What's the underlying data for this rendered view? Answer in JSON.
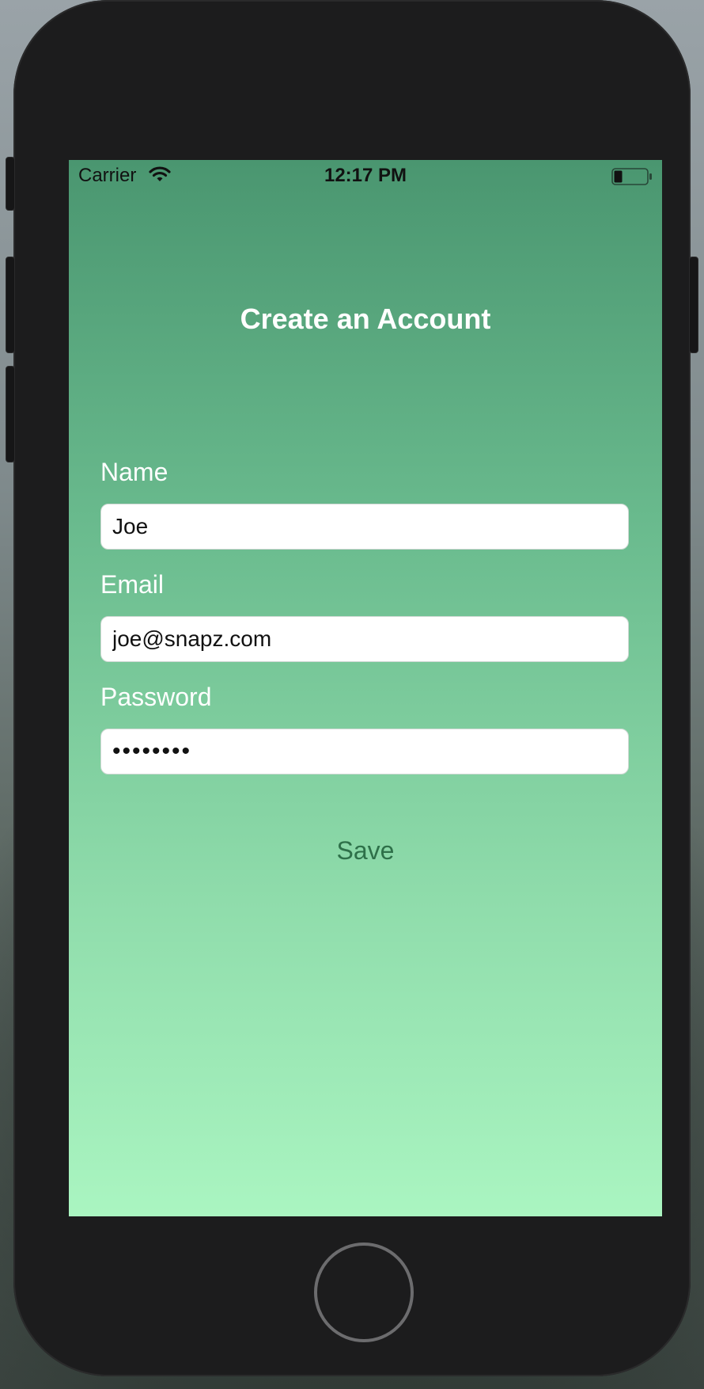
{
  "status_bar": {
    "carrier": "Carrier",
    "time": "12:17 PM",
    "wifi_icon": "wifi-icon",
    "battery_icon": "battery-icon",
    "battery_level": 0.25
  },
  "header": {
    "title": "Create an Account"
  },
  "form": {
    "name": {
      "label": "Name",
      "value": "Joe"
    },
    "email": {
      "label": "Email",
      "value": "joe@snapz.com"
    },
    "password": {
      "label": "Password",
      "value": "••••••••"
    },
    "save_label": "Save"
  },
  "colors": {
    "gradient_top": "#4a9670",
    "gradient_bottom": "#aaf5c1",
    "save_text": "#2e7049",
    "device_body": "#1c1c1d"
  },
  "device": {
    "home_button_icon": "home-button"
  }
}
